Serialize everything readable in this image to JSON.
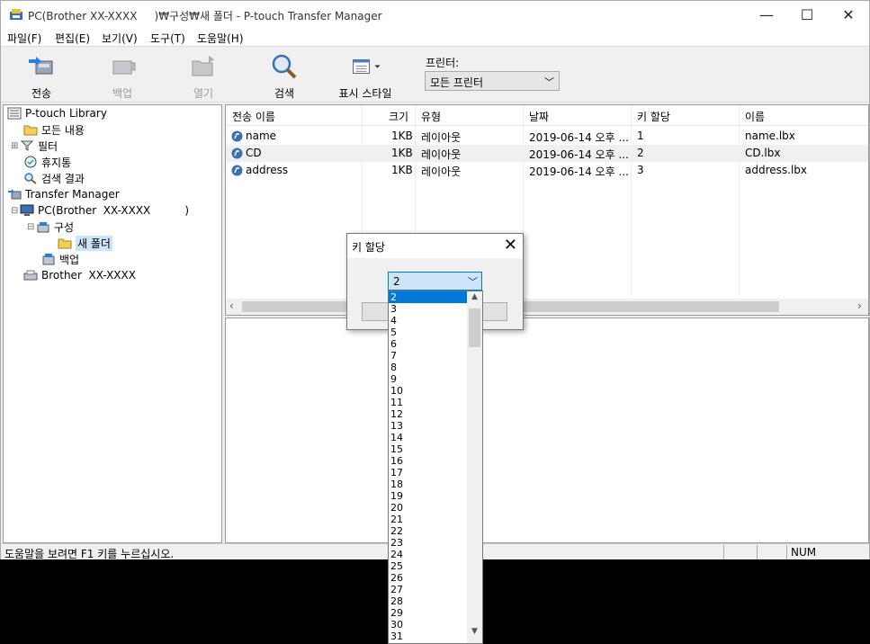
{
  "window": {
    "title": "PC(Brother XX-XXXX     )₩구성₩새 폴더 - P-touch Transfer Manager",
    "minimize_glyph": "—",
    "maximize_glyph": "☐",
    "close_glyph": "✕"
  },
  "menu": [
    "파일(F)",
    "편집(E)",
    "보기(V)",
    "도구(T)",
    "도움말(H)"
  ],
  "toolbar": {
    "transfer": "전송",
    "backup": "백업",
    "open": "열기",
    "search": "검색",
    "display_style": "표시 스타일",
    "printer_label": "프린터:",
    "printer_value": "모든 프린터"
  },
  "tree": [
    {
      "label": "P-touch Library",
      "icon": "library-icon"
    },
    {
      "label": "모든 내용",
      "icon": "folder-icon"
    },
    {
      "label": "필터",
      "icon": "filter-icon"
    },
    {
      "label": "휴지통",
      "icon": "trash-icon"
    },
    {
      "label": "검색 결과",
      "icon": "search-icon"
    },
    {
      "label": "Transfer Manager",
      "icon": "transfer-icon"
    },
    {
      "label": "PC(Brother  XX-XXXX          )",
      "icon": "computer-icon"
    },
    {
      "label": "구성",
      "icon": "config-icon"
    },
    {
      "label": "새 폴더",
      "icon": "folder-icon"
    },
    {
      "label": "백업",
      "icon": "backup-icon"
    },
    {
      "label": "Brother  XX-XXXX",
      "icon": "printer-icon"
    }
  ],
  "list": {
    "columns": [
      "전송 이름",
      "크기",
      "유형",
      "날짜",
      "키 할당",
      "이름"
    ],
    "rows": [
      {
        "name": "name",
        "size": "1KB",
        "type": "레이아웃",
        "date": "2019-06-14 오후 ...",
        "key": "1",
        "file": "name.lbx"
      },
      {
        "name": "CD",
        "size": "1KB",
        "type": "레이아웃",
        "date": "2019-06-14 오후 ...",
        "key": "2",
        "file": "CD.lbx"
      },
      {
        "name": "address",
        "size": "1KB",
        "type": "레이아웃",
        "date": "2019-06-14 오후 ...",
        "key": "3",
        "file": "address.lbx"
      }
    ]
  },
  "status": {
    "text": "도움말을 보려면 F1 키를 누르십시오.",
    "num": "NUM"
  },
  "dialog": {
    "title": "키 할당",
    "ok_label": "확",
    "cancel_label": "소",
    "selected": "2",
    "options": [
      "2",
      "3",
      "4",
      "5",
      "6",
      "7",
      "8",
      "9",
      "10",
      "11",
      "12",
      "13",
      "14",
      "15",
      "16",
      "17",
      "18",
      "19",
      "20",
      "21",
      "22",
      "23",
      "24",
      "25",
      "26",
      "27",
      "28",
      "29",
      "30",
      "31"
    ]
  }
}
